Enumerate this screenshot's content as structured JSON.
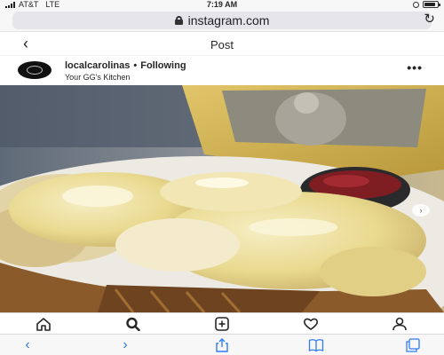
{
  "status_bar": {
    "carrier": "AT&T",
    "network": "LTE",
    "time": "7:19 AM",
    "battery_level": 0.85,
    "icons": [
      "signal-icon",
      "alarm-icon",
      "battery-icon"
    ]
  },
  "browser": {
    "url": "instagram.com",
    "icons": {
      "lock": "lock-icon",
      "reload": "reload-icon"
    }
  },
  "post_nav": {
    "title": "Post",
    "back_icon": "back-icon"
  },
  "author": {
    "username": "localcarolinas",
    "separator": "•",
    "follow_status": "Following",
    "location": "Your GG's Kitchen",
    "more_icon": "more-options-icon"
  },
  "photo": {
    "carousel_next_icon": "chevron-right-icon"
  },
  "ig_nav": {
    "items": [
      "home-icon",
      "search-icon",
      "new-post-icon",
      "activity-heart-icon",
      "profile-icon"
    ]
  },
  "safari_toolbar": {
    "items": [
      "back-arrow-icon",
      "forward-arrow-icon",
      "share-icon",
      "bookmarks-icon",
      "tabs-icon"
    ],
    "accent": "#2f7cf6"
  }
}
